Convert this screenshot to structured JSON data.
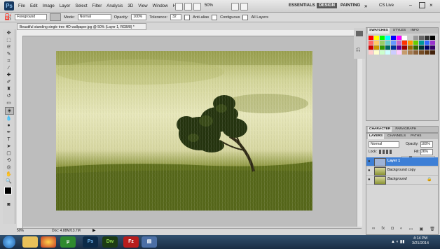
{
  "app": {
    "logo": "Ps"
  },
  "menu": [
    "File",
    "Edit",
    "Image",
    "Layer",
    "Select",
    "Filter",
    "Analysis",
    "3D",
    "View",
    "Window",
    "Help"
  ],
  "zoom_menu": "50%",
  "workspaces": {
    "essentials": "ESSENTIALS",
    "design": "DESIGN",
    "painting": "PAINTING",
    "more": "»",
    "cslive": "CS Live"
  },
  "options": {
    "preset": "Foreground",
    "mode_label": "Mode:",
    "mode_value": "Normal",
    "opacity_label": "Opacity:",
    "opacity_value": "100%",
    "tolerance_label": "Tolerance:",
    "tolerance_value": "32",
    "antialias": "Anti-alias",
    "contiguous": "Contiguous",
    "alllayers": "All Layers"
  },
  "document": {
    "tab_title": "Beautiful standing single tree HD wallpaper.jpg @ 50% (Layer 1, RGB/8) *",
    "zoom": "50%",
    "doc_size": "Doc: 4.88M/13.7M"
  },
  "swatches_tabs": [
    "SWATCHES",
    "STYLES",
    "INFO"
  ],
  "swatch_colors": [
    "#ff0000",
    "#ffff00",
    "#00ff00",
    "#00ffff",
    "#0000ff",
    "#ff00ff",
    "#ffffff",
    "#cccccc",
    "#999999",
    "#666666",
    "#333333",
    "#000000",
    "#ff6666",
    "#ffcc66",
    "#99cc66",
    "#66cccc",
    "#6699ff",
    "#cc66cc",
    "#ff3300",
    "#ff9900",
    "#66cc00",
    "#009999",
    "#3366ff",
    "#9933cc",
    "#cc0000",
    "#cc9900",
    "#339900",
    "#006666",
    "#003399",
    "#660099",
    "#990000",
    "#996600",
    "#336600",
    "#003333",
    "#000066",
    "#330066",
    "#ffcccc",
    "#ffffcc",
    "#ccffcc",
    "#ccffff",
    "#ccccff",
    "#ffccff",
    "#c69c6d",
    "#a67c52",
    "#8c6239",
    "#754c24",
    "#603913",
    "#42210b"
  ],
  "char_tabs": [
    "CHARACTER",
    "PARAGRAPH"
  ],
  "layers_tabs": [
    "LAYERS",
    "CHANNELS",
    "PATHS"
  ],
  "layers_panel": {
    "blend": "Normal",
    "opacity_label": "Opacity:",
    "opacity_value": "100%",
    "lock_label": "Lock:",
    "fill_label": "Fill:",
    "fill_value": "26%",
    "layers": [
      "Layer 1",
      "Background copy",
      "Background"
    ]
  },
  "taskbar": {
    "time": "4:14 PM",
    "date": "3/21/2014"
  }
}
